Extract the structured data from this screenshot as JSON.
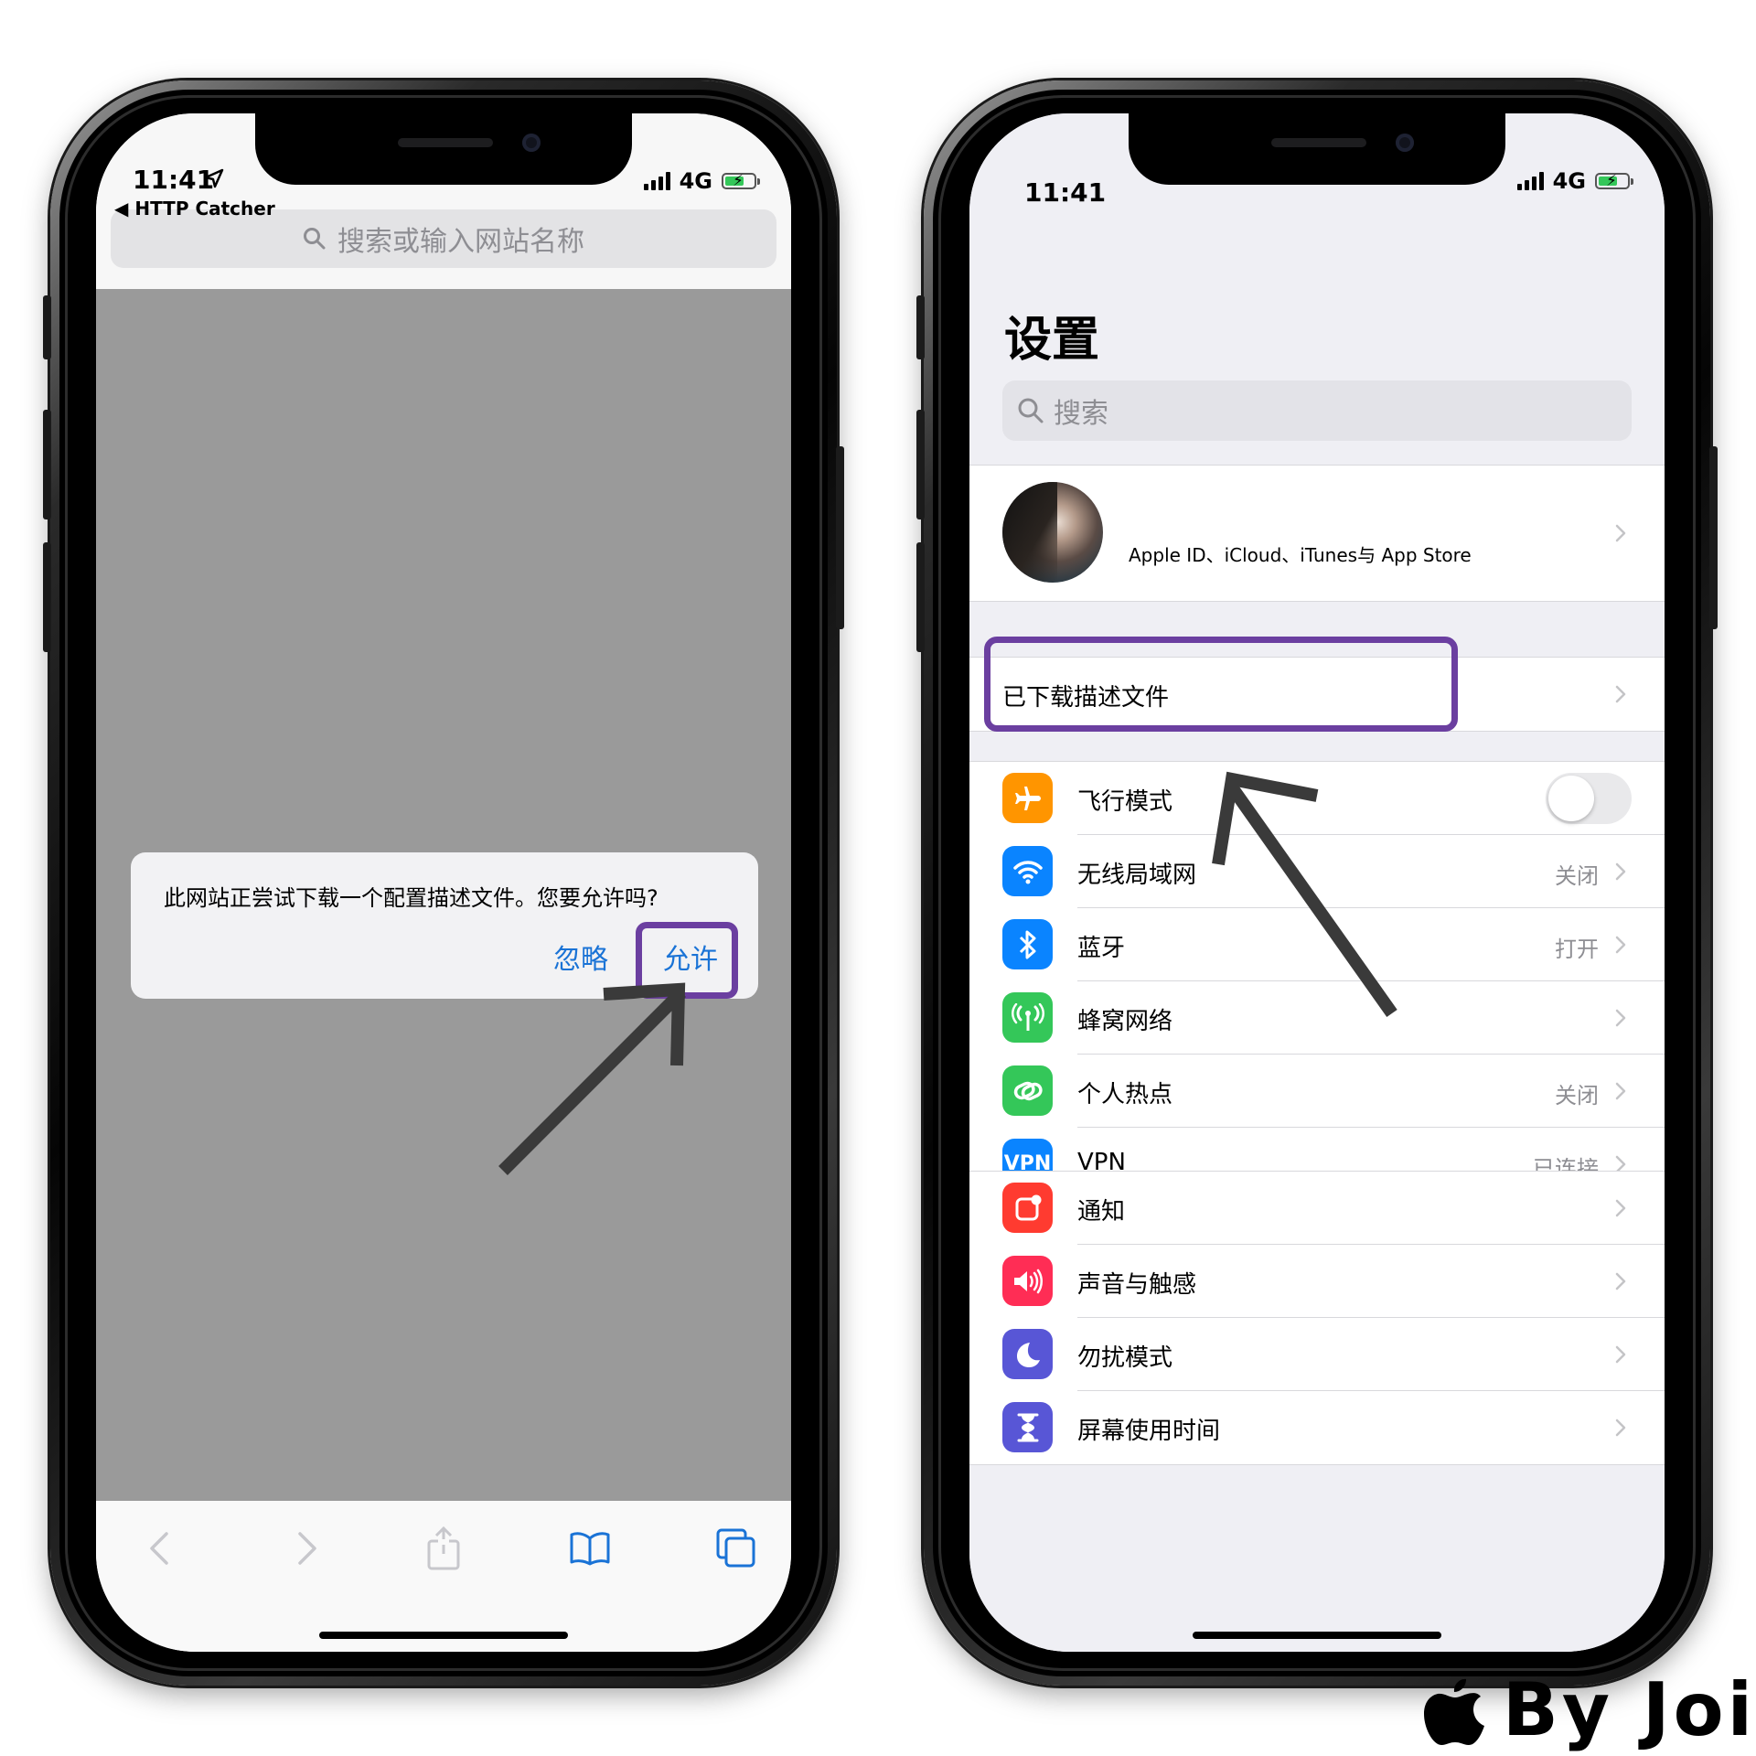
{
  "left_phone": {
    "status": {
      "time": "11:41",
      "network": "4G"
    },
    "back_app": "◀ HTTP Catcher",
    "urlbar": {
      "placeholder": "搜索或输入网站名称"
    },
    "alert": {
      "message": "此网站正尝试下载一个配置描述文件。您要允许吗?",
      "ignore_label": "忽略",
      "allow_label": "允许"
    },
    "toolbar": [
      "back-icon",
      "forward-icon",
      "share-icon",
      "bookmarks-icon",
      "tabs-icon"
    ]
  },
  "right_phone": {
    "status": {
      "time": "11:41",
      "network": "4G"
    },
    "title": "设置",
    "search_placeholder": "搜索",
    "profile": {
      "subtitle": "Apple ID、iCloud、iTunes与 App Store"
    },
    "profile_downloaded": {
      "label": "已下载描述文件"
    },
    "network_group": [
      {
        "label": "飞行模式",
        "value": "",
        "icon": "airplane-icon",
        "color": "#ff9500",
        "toggle": "off"
      },
      {
        "label": "无线局域网",
        "value": "关闭",
        "icon": "wifi-icon",
        "color": "#0a84ff"
      },
      {
        "label": "蓝牙",
        "value": "打开",
        "icon": "bluetooth-icon",
        "color": "#0a84ff"
      },
      {
        "label": "蜂窝网络",
        "value": "",
        "icon": "cellular-icon",
        "color": "#34c759"
      },
      {
        "label": "个人热点",
        "value": "关闭",
        "icon": "hotspot-icon",
        "color": "#34c759"
      },
      {
        "label": "VPN",
        "value": "已连接",
        "icon": "vpn-icon",
        "color": "#0a84ff",
        "icon_text": "VPN"
      }
    ],
    "notify_group": [
      {
        "label": "通知",
        "icon": "notifications-icon",
        "color": "#ff3b30"
      },
      {
        "label": "声音与触感",
        "icon": "sound-icon",
        "color": "#ff2d55"
      },
      {
        "label": "勿扰模式",
        "icon": "moon-icon",
        "color": "#5856d6"
      },
      {
        "label": "屏幕使用时间",
        "icon": "hourglass-icon",
        "color": "#5856d6"
      }
    ]
  },
  "watermark": {
    "text": "By Joi"
  },
  "colors": {
    "highlight": "#6b3fa0",
    "link": "#1a73d6",
    "arrow": "#3a3a3a"
  }
}
